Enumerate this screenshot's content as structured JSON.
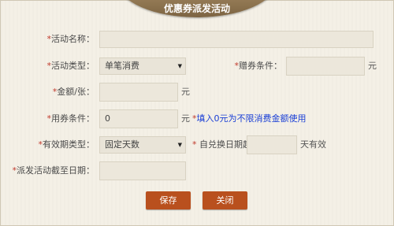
{
  "title": "优惠券派发活动",
  "form": {
    "activity_name": {
      "label": "活动名称：",
      "value": ""
    },
    "activity_type": {
      "label": "活动类型：",
      "selected": "单笔消费"
    },
    "gift_condition": {
      "label": "赠券条件：",
      "value": "",
      "unit": "元"
    },
    "amount_per_piece": {
      "label": "金额/张：",
      "value": "",
      "unit": "元"
    },
    "use_condition": {
      "label": "用券条件：",
      "value": "0",
      "unit": "元",
      "hint": "填入0元为不限消费金额使用"
    },
    "validity_type": {
      "label": "有效期类型：",
      "selected": "固定天数"
    },
    "valid_from_redeem": {
      "label": "自兑换日期起",
      "value": "",
      "unit": "天有效"
    },
    "deadline": {
      "label": "派发活动截至日期：",
      "value": ""
    }
  },
  "buttons": {
    "save": "保存",
    "close": "关闭"
  },
  "colors": {
    "button": "#b9501e",
    "title_tab": "#8c7350",
    "hint": "#1a3fd6",
    "required_star": "#c0392b"
  }
}
